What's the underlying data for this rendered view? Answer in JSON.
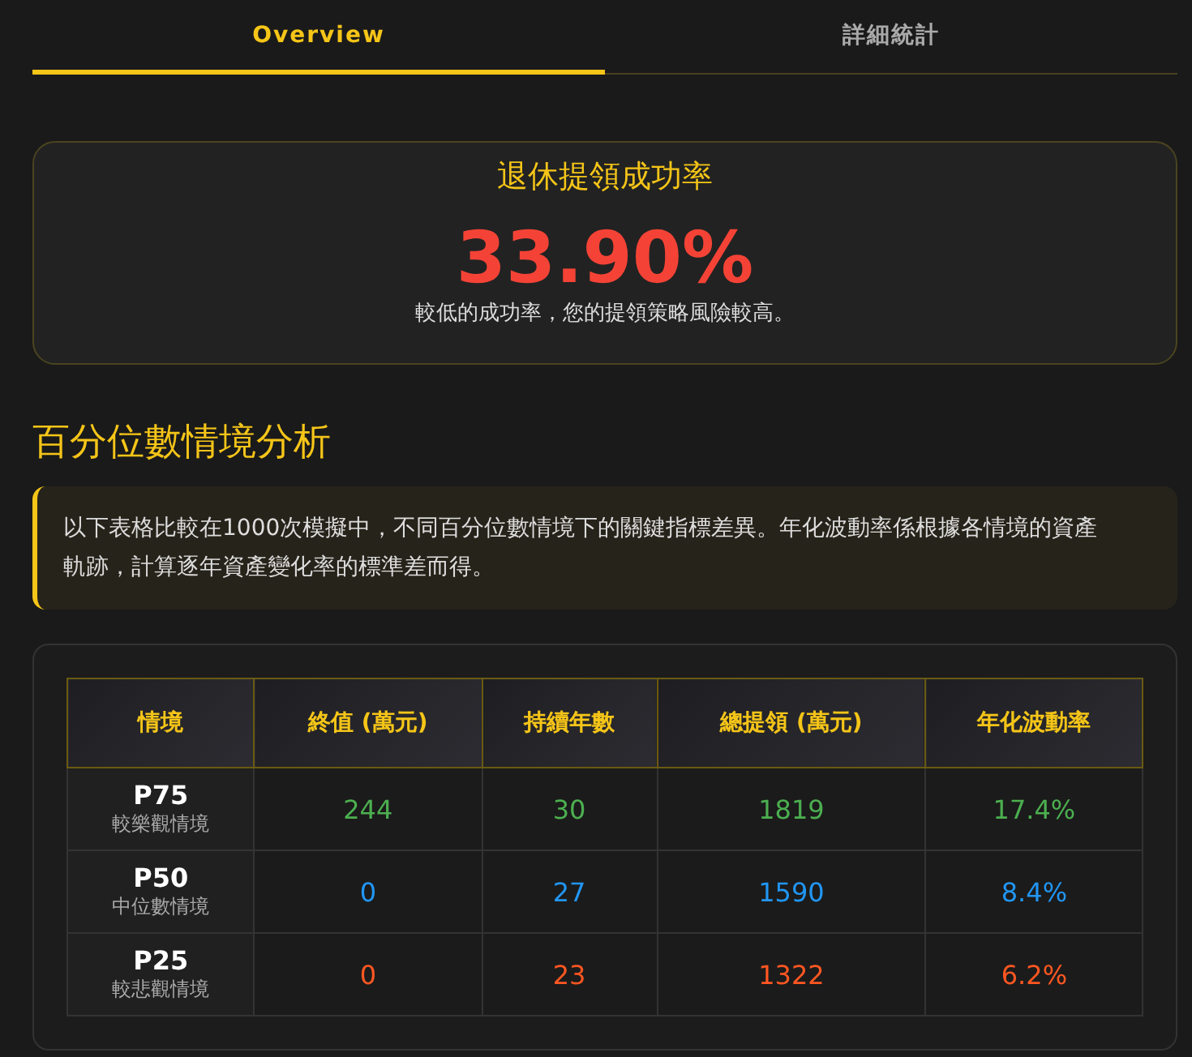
{
  "tabs": [
    {
      "label": "Overview",
      "selected": true
    },
    {
      "label": "詳細統計",
      "selected": false
    }
  ],
  "success_card": {
    "title": "退休提領成功率",
    "rate": "33.90%",
    "note": "較低的成功率，您的提領策略風險較高。"
  },
  "section_title": "百分位數情境分析",
  "info_note": "以下表格比較在1000次模擬中，不同百分位數情境下的關鍵指標差異。年化波動率係根據各情境的資產軌跡，計算逐年資產變化率的標準差而得。",
  "table": {
    "columns": [
      "情境",
      "終值 (萬元)",
      "持續年數",
      "總提領 (萬元)",
      "年化波動率"
    ],
    "rows": [
      {
        "color": "#4caf50",
        "cells": [
          {
            "text": "P75",
            "subtext": "較樂觀情境"
          },
          {
            "text": "244"
          },
          {
            "text": "30"
          },
          {
            "text": "1819"
          },
          {
            "text": "17.4%"
          }
        ]
      },
      {
        "color": "#2196f3",
        "cells": [
          {
            "text": "P50",
            "subtext": "中位數情境"
          },
          {
            "text": "0"
          },
          {
            "text": "27"
          },
          {
            "text": "1590"
          },
          {
            "text": "8.4%"
          }
        ]
      },
      {
        "color": "#ff5722",
        "cells": [
          {
            "text": "P25",
            "subtext": "較悲觀情境"
          },
          {
            "text": "0"
          },
          {
            "text": "23"
          },
          {
            "text": "1322"
          },
          {
            "text": "6.2%"
          }
        ]
      }
    ]
  }
}
